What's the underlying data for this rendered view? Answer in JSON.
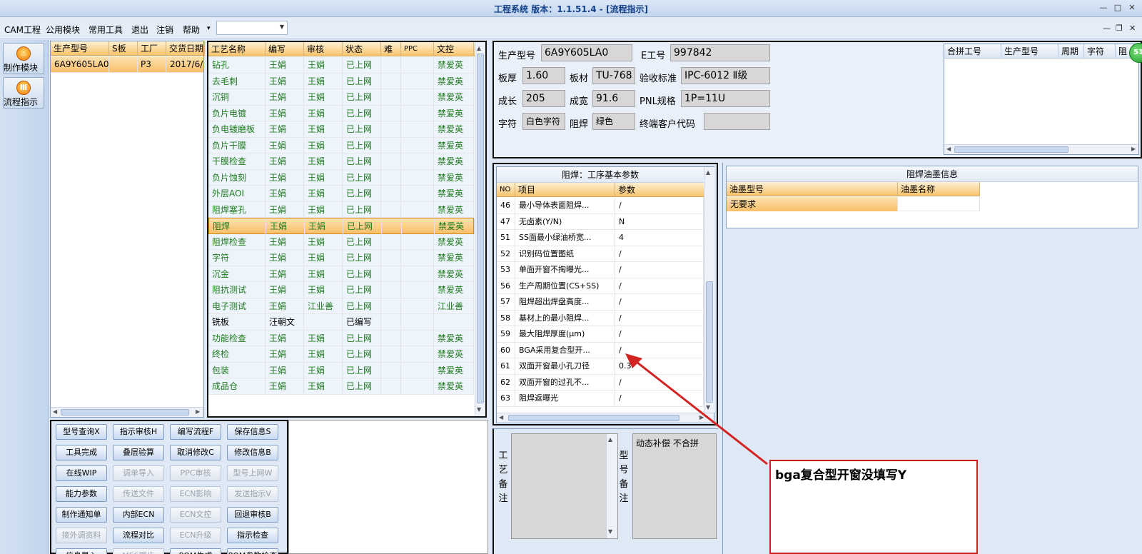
{
  "window": {
    "title": "工程系统  版本：1.1.51.4 - [流程指示]",
    "controls": [
      "—",
      "□",
      "✕"
    ],
    "mdi_controls": [
      "—",
      "❐",
      "✕"
    ]
  },
  "menu": {
    "items": [
      "CAM工程",
      "公用模块",
      "常用工具",
      "退出",
      "注销",
      "帮助"
    ],
    "help_arrow": "▾",
    "combo_value": ""
  },
  "nav": {
    "items": [
      {
        "label": "制作模块",
        "icon": "fire-icon"
      },
      {
        "label": "流程指示",
        "icon": "flow-icon"
      }
    ]
  },
  "product_grid": {
    "columns": [
      "生产型号",
      "S板",
      "工厂",
      "交货日期"
    ],
    "rows": [
      {
        "model": "6A9Y605LA0",
        "s": "",
        "factory": "P3",
        "date": "2017/6/"
      }
    ]
  },
  "process_grid": {
    "columns": [
      "工艺名称",
      "编写",
      "审核",
      "状态",
      "难",
      "PPC",
      "文控"
    ],
    "rows": [
      {
        "name": "钻孔",
        "writer": "王娟",
        "reviewer": "王娟",
        "status": "已上网",
        "difficulty": "",
        "ppc": "",
        "doc": "禁爱英"
      },
      {
        "name": "去毛刺",
        "writer": "王娟",
        "reviewer": "王娟",
        "status": "已上网",
        "difficulty": "",
        "ppc": "",
        "doc": "禁爱英"
      },
      {
        "name": "沉铜",
        "writer": "王娟",
        "reviewer": "王娟",
        "status": "已上网",
        "difficulty": "",
        "ppc": "",
        "doc": "禁爱英"
      },
      {
        "name": "负片电镀",
        "writer": "王娟",
        "reviewer": "王娟",
        "status": "已上网",
        "difficulty": "",
        "ppc": "",
        "doc": "禁爱英"
      },
      {
        "name": "负电镀磨板",
        "writer": "王娟",
        "reviewer": "王娟",
        "status": "已上网",
        "difficulty": "",
        "ppc": "",
        "doc": "禁爱英"
      },
      {
        "name": "负片干膜",
        "writer": "王娟",
        "reviewer": "王娟",
        "status": "已上网",
        "difficulty": "",
        "ppc": "",
        "doc": "禁爱英"
      },
      {
        "name": "干膜检查",
        "writer": "王娟",
        "reviewer": "王娟",
        "status": "已上网",
        "difficulty": "",
        "ppc": "",
        "doc": "禁爱英"
      },
      {
        "name": "负片蚀刻",
        "writer": "王娟",
        "reviewer": "王娟",
        "status": "已上网",
        "difficulty": "",
        "ppc": "",
        "doc": "禁爱英"
      },
      {
        "name": "外层AOI",
        "writer": "王娟",
        "reviewer": "王娟",
        "status": "已上网",
        "difficulty": "",
        "ppc": "",
        "doc": "禁爱英"
      },
      {
        "name": "阻焊塞孔",
        "writer": "王娟",
        "reviewer": "王娟",
        "status": "已上网",
        "difficulty": "",
        "ppc": "",
        "doc": "禁爱英"
      },
      {
        "name": "阻焊",
        "writer": "王娟",
        "reviewer": "王娟",
        "status": "已上网",
        "difficulty": "",
        "ppc": "",
        "doc": "禁爱英"
      },
      {
        "name": "阻焊检查",
        "writer": "王娟",
        "reviewer": "王娟",
        "status": "已上网",
        "difficulty": "",
        "ppc": "",
        "doc": "禁爱英"
      },
      {
        "name": "字符",
        "writer": "王娟",
        "reviewer": "王娟",
        "status": "已上网",
        "difficulty": "",
        "ppc": "",
        "doc": "禁爱英"
      },
      {
        "name": "沉金",
        "writer": "王娟",
        "reviewer": "王娟",
        "status": "已上网",
        "difficulty": "",
        "ppc": "",
        "doc": "禁爱英"
      },
      {
        "name": "阻抗测试",
        "writer": "王娟",
        "reviewer": "王娟",
        "status": "已上网",
        "difficulty": "",
        "ppc": "",
        "doc": "禁爱英"
      },
      {
        "name": "电子测试",
        "writer": "王娟",
        "reviewer": "江业善",
        "status": "已上网",
        "difficulty": "",
        "ppc": "",
        "doc": "江业善"
      },
      {
        "name": "铣板",
        "writer": "汪朝文",
        "reviewer": "",
        "status": "已编写",
        "difficulty": "",
        "ppc": "",
        "doc": ""
      },
      {
        "name": "功能检查",
        "writer": "王娟",
        "reviewer": "王娟",
        "status": "已上网",
        "difficulty": "",
        "ppc": "",
        "doc": "禁爱英"
      },
      {
        "name": "终检",
        "writer": "王娟",
        "reviewer": "王娟",
        "status": "已上网",
        "difficulty": "",
        "ppc": "",
        "doc": "禁爱英"
      },
      {
        "name": "包装",
        "writer": "王娟",
        "reviewer": "王娟",
        "status": "已上网",
        "difficulty": "",
        "ppc": "",
        "doc": "禁爱英"
      },
      {
        "name": "成品仓",
        "writer": "王娟",
        "reviewer": "王娟",
        "status": "已上网",
        "difficulty": "",
        "ppc": "",
        "doc": "禁爱英"
      }
    ],
    "selected_index": 10
  },
  "buttons": [
    {
      "label": "型号查询X",
      "enabled": true
    },
    {
      "label": "指示审核H",
      "enabled": true
    },
    {
      "label": "编写流程F",
      "enabled": true
    },
    {
      "label": "保存信息S",
      "enabled": true
    },
    {
      "label": "工具完成",
      "enabled": true
    },
    {
      "label": "叠层验算",
      "enabled": true
    },
    {
      "label": "取消修改C",
      "enabled": true
    },
    {
      "label": "修改信息B",
      "enabled": true
    },
    {
      "label": "在线WIP",
      "enabled": true
    },
    {
      "label": "调单导入",
      "enabled": false
    },
    {
      "label": "PPC审核",
      "enabled": false
    },
    {
      "label": "型号上网W",
      "enabled": false
    },
    {
      "label": "能力参数",
      "enabled": true
    },
    {
      "label": "传送文件",
      "enabled": false
    },
    {
      "label": "ECN影响",
      "enabled": false
    },
    {
      "label": "发送指示V",
      "enabled": false
    },
    {
      "label": "制作通知单",
      "enabled": true
    },
    {
      "label": "内部ECN",
      "enabled": true
    },
    {
      "label": "ECN文控",
      "enabled": false
    },
    {
      "label": "回退审核B",
      "enabled": true
    },
    {
      "label": "接外调资料",
      "enabled": false
    },
    {
      "label": "流程对比",
      "enabled": true
    },
    {
      "label": "ECN升级",
      "enabled": false
    },
    {
      "label": "指示检查",
      "enabled": true
    },
    {
      "label": "信息导入",
      "enabled": true
    },
    {
      "label": "MES同步",
      "enabled": false
    },
    {
      "label": "POM生成",
      "enabled": true
    },
    {
      "label": "POM参数检查",
      "enabled": true
    }
  ],
  "info": {
    "model_label": "生产型号",
    "model": "6A9Y605LA0",
    "eno_label": "E工号",
    "eno": "997842",
    "thickness_label": "板厚",
    "thickness": "1.60",
    "material_label": "板材",
    "material": "TU-768",
    "standard_label": "验收标准",
    "standard": "IPC-6012 Ⅱ级",
    "length_label": "成长",
    "length": "205",
    "width_label": "成宽",
    "width": "91.6",
    "pnl_label": "PNL规格",
    "pnl": "1P=11U",
    "char_label": "字符",
    "char": "白色字符",
    "mask_label": "阻焊",
    "mask": "绿色",
    "customer_label": "终端客户代码",
    "customer": ""
  },
  "combine_grid": {
    "columns": [
      "合拼工号",
      "生产型号",
      "周期",
      "字符",
      "阻"
    ],
    "badge": "51"
  },
  "params": {
    "title": "阻焊：工序基本参数",
    "columns": [
      "NO",
      "项目",
      "参数"
    ],
    "rows": [
      {
        "no": "46",
        "item": "最小导体表面阻焊...",
        "value": "/"
      },
      {
        "no": "47",
        "item": "无卤素(Y/N)",
        "value": "N"
      },
      {
        "no": "51",
        "item": "SS面最小绿油桥宽...",
        "value": "4"
      },
      {
        "no": "52",
        "item": "识别码位置图纸",
        "value": "/"
      },
      {
        "no": "53",
        "item": "单面开窗不掏曝光...",
        "value": "/"
      },
      {
        "no": "56",
        "item": "生产周期位置(CS+SS)",
        "value": "/"
      },
      {
        "no": "57",
        "item": "阻焊超出焊盘高度...",
        "value": "/"
      },
      {
        "no": "58",
        "item": "基材上的最小阻焊...",
        "value": "/"
      },
      {
        "no": "59",
        "item": "最大阻焊厚度(μm)",
        "value": "/"
      },
      {
        "no": "60",
        "item": "BGA采用复合型开...",
        "value": "/"
      },
      {
        "no": "61",
        "item": "双面开窗最小孔刀径",
        "value": "0.3"
      },
      {
        "no": "62",
        "item": "双面开窗的过孔不...",
        "value": "/"
      },
      {
        "no": "63",
        "item": "阻焊返曝光",
        "value": "/"
      }
    ]
  },
  "ink": {
    "title": "阻焊油墨信息",
    "columns": [
      "油墨型号",
      "油墨名称"
    ],
    "rows": [
      {
        "type": "无要求",
        "name": ""
      }
    ]
  },
  "notes": {
    "process_label": "工艺备注",
    "model_label": "型号备注",
    "model_text": "动态补偿  不合拼"
  },
  "callout": {
    "text": "bga复合型开窗没填写Y",
    "color": "#cc1f1f"
  }
}
